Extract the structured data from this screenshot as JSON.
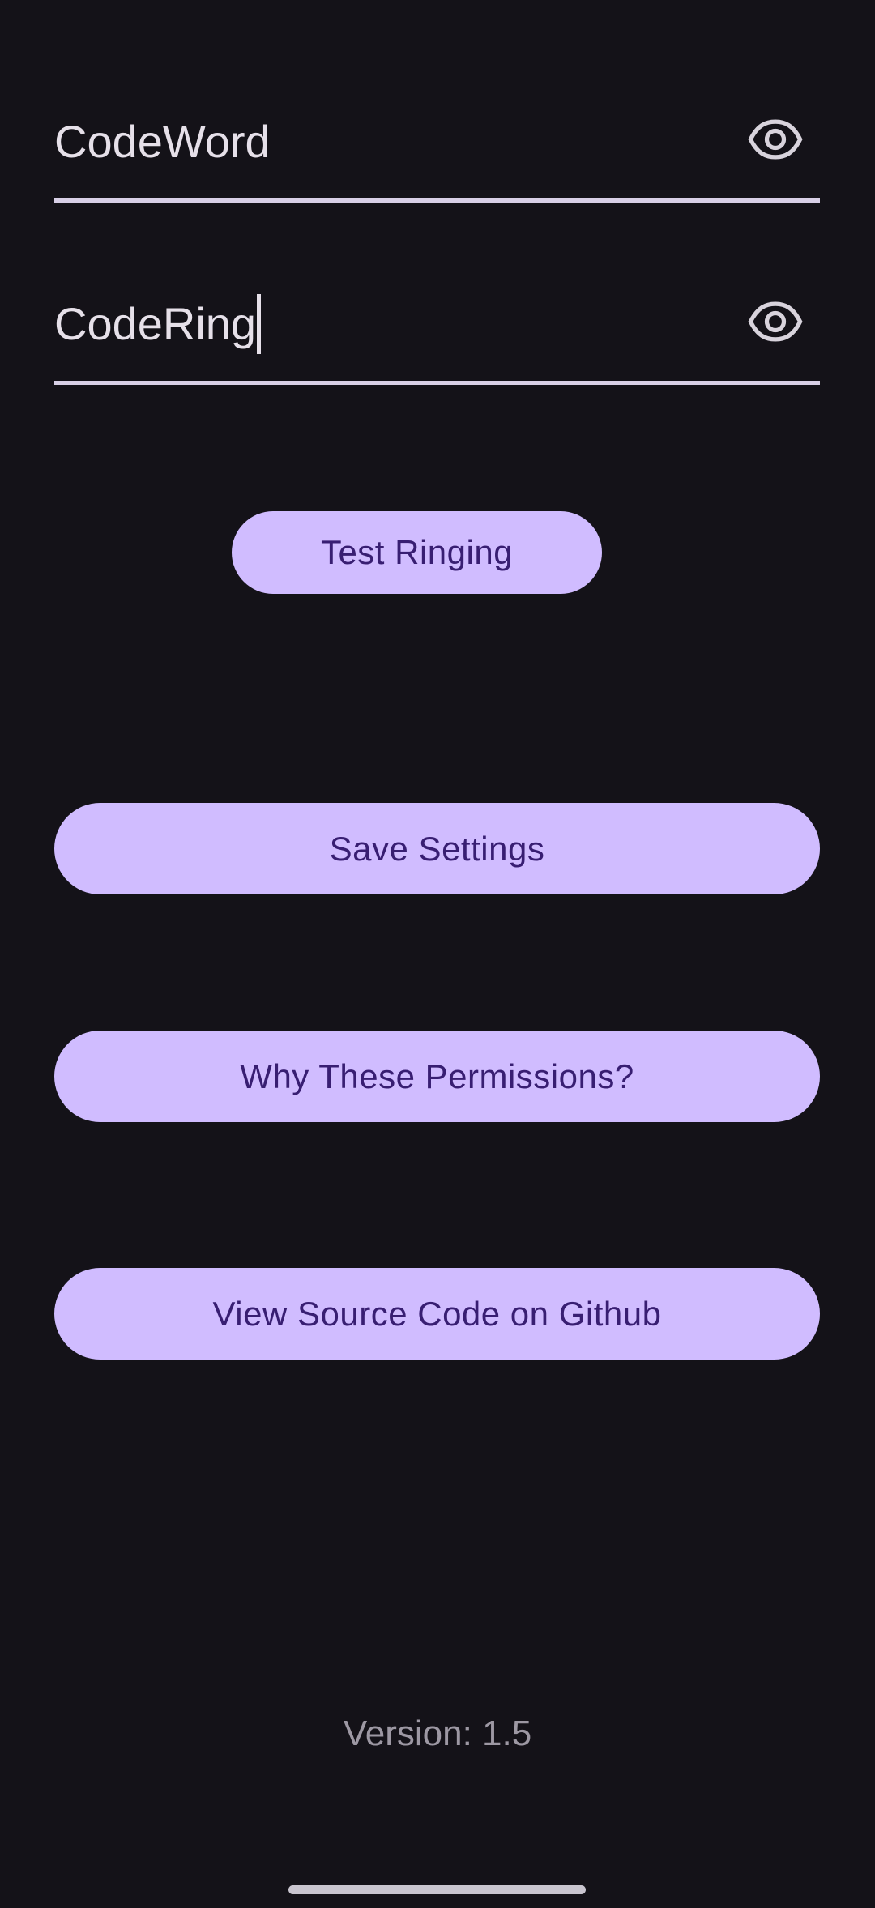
{
  "fields": {
    "codeword": {
      "value": "CodeWord",
      "toggle_icon": "eye-icon"
    },
    "codering": {
      "value": "CodeRing",
      "toggle_icon": "eye-icon"
    }
  },
  "buttons": {
    "test_ringing": "Test Ringing",
    "save_settings": "Save Settings",
    "why_permissions": "Why These Permissions?",
    "view_source": "View Source Code on Github"
  },
  "footer": {
    "version": "Version: 1.5"
  },
  "colors": {
    "background": "#141218",
    "button_fill": "#d0bcff",
    "button_text": "#381e72",
    "field_text": "#e6e0e9",
    "underline": "#d8cfe6",
    "version_text": "#9d98a3"
  }
}
